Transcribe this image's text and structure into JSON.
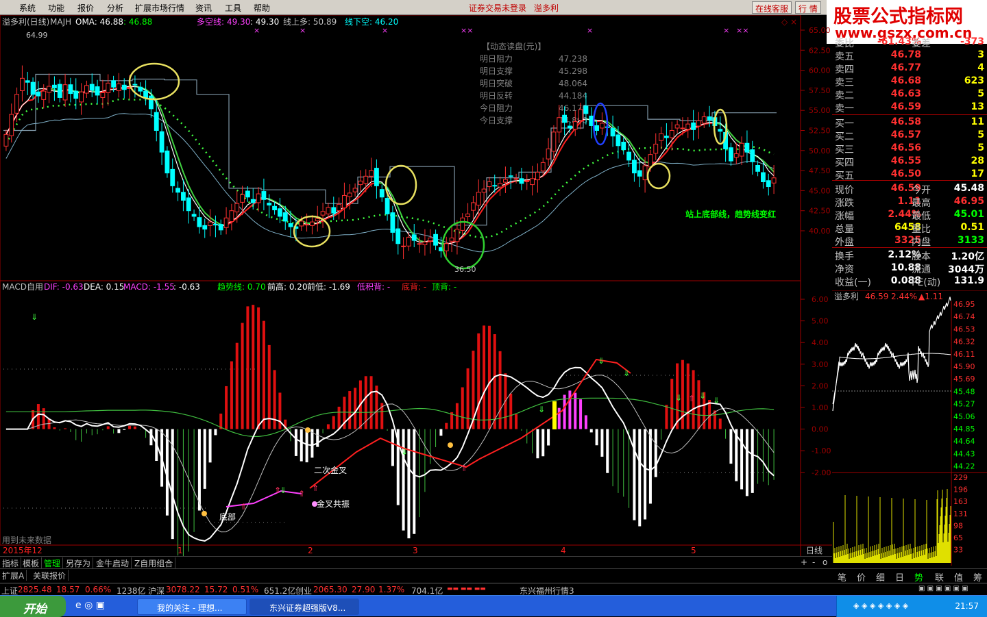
{
  "menubar": {
    "items": [
      "系统",
      "功能",
      "报价",
      "分析",
      "扩展市场行情",
      "资讯",
      "工具",
      "帮助"
    ],
    "center_status": "证券交易未登录",
    "center_stock": "溢多利",
    "online_service": "在线客服",
    "quote_btn": "行 情"
  },
  "logo": {
    "title": "股票公式指标网",
    "url": "www.gszx.com.cn"
  },
  "kline": {
    "header_name": "溢多利(日线)",
    "header_majh": "MAJH",
    "oma_label": "OMA: 46.88",
    "oma_value": ": 46.88",
    "duokong_label": "多空线:",
    "duokong_value": "49.30",
    "duokong_value2": ": 49.30",
    "xianshangduo": "线上多: 50.89",
    "xianxiakong": "线下空: 46.20",
    "high_mark": "64.99",
    "low_mark": "36.50",
    "yaxis": [
      "65.00",
      "62.50",
      "60.00",
      "57.50",
      "55.00",
      "52.50",
      "50.00",
      "47.50",
      "45.00",
      "42.50",
      "40.00"
    ],
    "annotation": "站上底部线，趋势线变红",
    "pan_title": "【动态读盘(元)】",
    "pan_rows": [
      {
        "label": "明日阻力",
        "value": "47.238"
      },
      {
        "label": "明日支撑",
        "value": "45.298"
      },
      {
        "label": "明日突破",
        "value": "48.064"
      },
      {
        "label": "明日反转",
        "value": "44.184"
      },
      {
        "label": "今日阻力",
        "value": "46.170"
      },
      {
        "label": "今日支撑",
        "value": "44.896"
      }
    ]
  },
  "macd": {
    "title": "MACD自用",
    "dif": "DIF: -0.63",
    "dea": "DEA: 0.15",
    "macd": "MACD: -1.55",
    "extra": ": -0.63",
    "trend": "趋势线: 0.70",
    "qiangao": "前高: 0.20",
    "qiandi": "前低: -1.69",
    "dijibei": "低积背: -",
    "dibei": "底背: -",
    "dingbei": "顶背: -",
    "yaxis": [
      "6.00",
      "5.00",
      "4.00",
      "3.00",
      "2.00",
      "1.00",
      "0.00",
      "-1.00",
      "-2.00"
    ],
    "label_erci": "二次金叉",
    "label_jinchagongzhen": "金叉共振",
    "label_dibu": "底部",
    "label_weilai": "用到未来数据"
  },
  "timeaxis": {
    "start": "2015年12",
    "months": [
      "1",
      "2",
      "3",
      "4",
      "5"
    ],
    "period": "日线"
  },
  "tabs": [
    "指标",
    "模板",
    "管理",
    "另存为",
    "金牛启动",
    "Z自用组合"
  ],
  "tabs2": [
    "扩展A",
    "关联报价"
  ],
  "quote": {
    "weibi_label": "委比",
    "weibi_value": "-61.43%",
    "weicha_label": "委差",
    "weicha_value": "-373",
    "sells": [
      {
        "label": "卖五",
        "price": "46.78",
        "vol": "3"
      },
      {
        "label": "卖四",
        "price": "46.77",
        "vol": "4"
      },
      {
        "label": "卖三",
        "price": "46.68",
        "vol": "623"
      },
      {
        "label": "卖二",
        "price": "46.63",
        "vol": "5"
      },
      {
        "label": "卖一",
        "price": "46.59",
        "vol": "13"
      }
    ],
    "buys": [
      {
        "label": "买一",
        "price": "46.58",
        "vol": "11"
      },
      {
        "label": "买二",
        "price": "46.57",
        "vol": "5"
      },
      {
        "label": "买三",
        "price": "46.56",
        "vol": "5"
      },
      {
        "label": "买四",
        "price": "46.55",
        "vol": "28"
      },
      {
        "label": "买五",
        "price": "46.50",
        "vol": "17"
      }
    ],
    "stats": [
      {
        "l1": "现价",
        "v1": "46.59",
        "l2": "今开",
        "v2": "45.48"
      },
      {
        "l1": "涨跌",
        "v1": "1.11",
        "l2": "最高",
        "v2": "46.95"
      },
      {
        "l1": "涨幅",
        "v1": "2.44%",
        "l2": "最低",
        "v2": "45.01"
      },
      {
        "l1": "总量",
        "v1": "6458",
        "l2": "量比",
        "v2": "0.51"
      },
      {
        "l1": "外盘",
        "v1": "3325",
        "l2": "内盘",
        "v2": "3133"
      }
    ],
    "stats2": [
      {
        "l1": "换手",
        "v1": "2.12%",
        "l2": "股本",
        "v2": "1.20亿"
      },
      {
        "l1": "净资",
        "v1": "10.88",
        "l2": "流通",
        "v2": "3044万"
      },
      {
        "l1": "收益(一)",
        "v1": "0.088",
        "l2": "PE(动)",
        "v2": "131.9"
      }
    ]
  },
  "intraday": {
    "title": "溢多利",
    "price": "46.59",
    "pct": "2.44%",
    "chg": "▲1.11",
    "yaxis": [
      "46.95",
      "46.74",
      "46.53",
      "46.32",
      "46.11",
      "45.90",
      "45.69",
      "45.48",
      "45.27",
      "45.06",
      "44.85",
      "44.64",
      "44.43",
      "44.22"
    ],
    "vol_axis": [
      "229",
      "196",
      "163",
      "131",
      "98",
      "65",
      "33"
    ]
  },
  "bottom_tabs": [
    "笔",
    "价",
    "细",
    "日",
    "势",
    "联",
    "值",
    "筹"
  ],
  "statusbar": {
    "sh_label": "上证",
    "sh_value": "2825.48",
    "sh_chg": "18.57",
    "sh_pct": "0.66%",
    "sh_amt": "1238亿",
    "sz_label": "沪深",
    "sz_value": "3078.22",
    "sz_chg": "15.72",
    "sz_pct": "0.51%",
    "sz_amt": "651.2亿",
    "cy_label": "创业",
    "cy_value": "2065.30",
    "cy_chg": "27.90",
    "cy_pct": "1.37%",
    "cy_amt": "704.1亿",
    "server": "东兴福州行情3"
  },
  "taskbar": {
    "start": "开始",
    "btn1": "我的关注 - 理想...",
    "btn2": "东兴证券超强版V8...",
    "clock": "21:57"
  }
}
